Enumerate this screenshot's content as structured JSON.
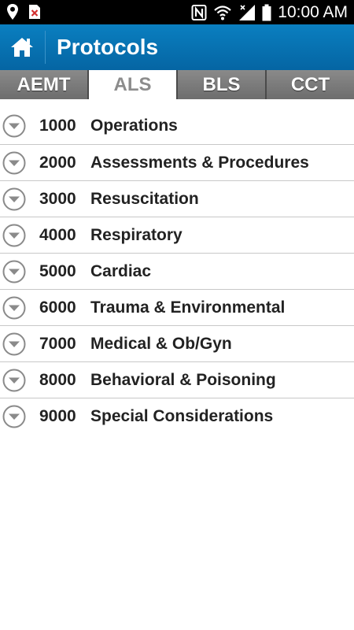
{
  "status_bar": {
    "time": "10:00 AM",
    "icons": [
      "location-icon",
      "notification-icon",
      "nfc-icon",
      "wifi-icon",
      "signal-icon",
      "battery-icon"
    ]
  },
  "app_bar": {
    "title": "Protocols",
    "home_icon": "home-icon",
    "color": "#0a7fc0"
  },
  "tabs": [
    {
      "label": "AEMT",
      "active": false
    },
    {
      "label": "ALS",
      "active": true
    },
    {
      "label": "BLS",
      "active": false
    },
    {
      "label": "CCT",
      "active": false
    }
  ],
  "protocols": [
    {
      "code": "1000",
      "name": "Operations"
    },
    {
      "code": "2000",
      "name": "Assessments & Procedures"
    },
    {
      "code": "3000",
      "name": "Resuscitation"
    },
    {
      "code": "4000",
      "name": "Respiratory"
    },
    {
      "code": "5000",
      "name": "Cardiac"
    },
    {
      "code": "6000",
      "name": "Trauma & Environmental"
    },
    {
      "code": "7000",
      "name": "Medical & Ob/Gyn"
    },
    {
      "code": "8000",
      "name": "Behavioral & Poisoning"
    },
    {
      "code": "9000",
      "name": "Special Considerations"
    }
  ]
}
